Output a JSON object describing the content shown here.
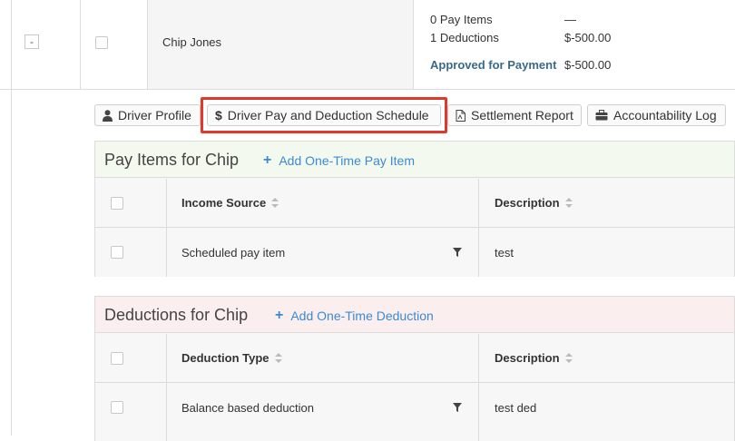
{
  "driver_row": {
    "collapse_symbol": "-",
    "name": "Chip Jones",
    "summary": [
      {
        "label": "0 Pay Items",
        "value": "—"
      },
      {
        "label": "1 Deductions",
        "value": "$-500.00"
      },
      {
        "label": "Approved for Payment",
        "value": "$-500.00"
      }
    ]
  },
  "tabs": [
    {
      "label": "Driver Profile",
      "icon": "user-icon"
    },
    {
      "label": "Driver Pay and Deduction Schedule",
      "icon": "dollar-icon"
    },
    {
      "label": "Settlement Report",
      "icon": "pdf-file-icon"
    },
    {
      "label": "Accountability Log",
      "icon": "briefcase-icon"
    }
  ],
  "pay_items": {
    "title": "Pay Items for Chip",
    "add_label": "Add One-Time Pay Item",
    "header_color": "#f4f9ef",
    "columns": [
      "Income Source",
      "Description"
    ],
    "rows": [
      {
        "source": "Scheduled pay item",
        "description": "test"
      }
    ]
  },
  "deductions": {
    "title": "Deductions for Chip",
    "add_label": "Add One-Time Deduction",
    "header_color": "#fbeeee",
    "columns": [
      "Deduction Type",
      "Description"
    ],
    "rows": [
      {
        "type": "Balance based deduction",
        "description": "test ded"
      }
    ]
  },
  "colors": {
    "accent": "#3a8ad4",
    "highlight": "#e0392b",
    "approved": "#3a6a8a"
  }
}
